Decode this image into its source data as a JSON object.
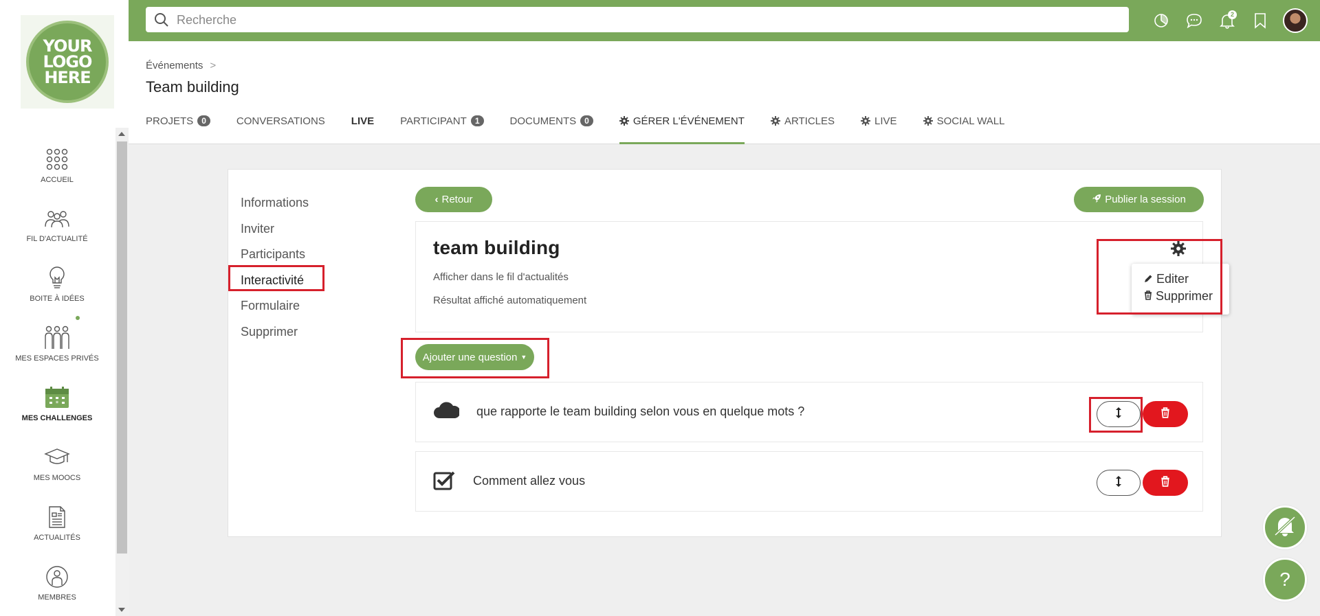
{
  "logo": {
    "line1": "YOUR",
    "line2": "LOGO",
    "line3": "HERE"
  },
  "sidebar": {
    "items": [
      {
        "label": "ACCUEIL",
        "icon": "grid-dots-icon"
      },
      {
        "label": "FIL D'ACTUALITÉ",
        "icon": "people-group-icon"
      },
      {
        "label": "BOITE À IDÉES",
        "icon": "lightbulb-icon"
      },
      {
        "label": "MES ESPACES PRIVÉS",
        "icon": "private-spaces-icon"
      },
      {
        "label": "MES CHALLENGES",
        "icon": "calendar-icon"
      },
      {
        "label": "MES MOOCS",
        "icon": "graduation-cap-icon"
      },
      {
        "label": "ACTUALITÉS",
        "icon": "document-icon"
      },
      {
        "label": "MEMBRES",
        "icon": "member-icon"
      }
    ]
  },
  "search": {
    "placeholder": "Recherche"
  },
  "topbar": {
    "notification_count": "2"
  },
  "breadcrumb": {
    "parent": "Événements"
  },
  "page": {
    "title": "Team building"
  },
  "tabs": [
    {
      "label": "PROJETS",
      "count": "0"
    },
    {
      "label": "CONVERSATIONS"
    },
    {
      "label": "LIVE"
    },
    {
      "label": "PARTICIPANT",
      "count": "1"
    },
    {
      "label": "DOCUMENTS",
      "count": "0"
    },
    {
      "label": "GÉRER L'ÉVÉNEMENT"
    },
    {
      "label": "ARTICLES"
    },
    {
      "label": "LIVE"
    },
    {
      "label": "SOCIAL WALL"
    }
  ],
  "side_menu": [
    "Informations",
    "Inviter",
    "Participants",
    "Interactivité",
    "Formulaire",
    "Supprimer"
  ],
  "buttons": {
    "back": "Retour",
    "publish": "Publier la session",
    "add_question": "Ajouter une question"
  },
  "session": {
    "title": "team building",
    "line1": "Afficher dans le fil d'actualités",
    "line2": "Résultat affiché automatiquement"
  },
  "dropdown": {
    "edit": "Editer",
    "delete": "Supprimer"
  },
  "questions": [
    {
      "text": "que rapporte le team building selon vous en quelque mots ?",
      "icon": "cloud-icon"
    },
    {
      "text": "Comment allez vous",
      "icon": "checkbox-icon"
    }
  ],
  "colors": {
    "brand": "#7aa85a",
    "danger": "#e2171e",
    "highlight": "#d6202c"
  }
}
